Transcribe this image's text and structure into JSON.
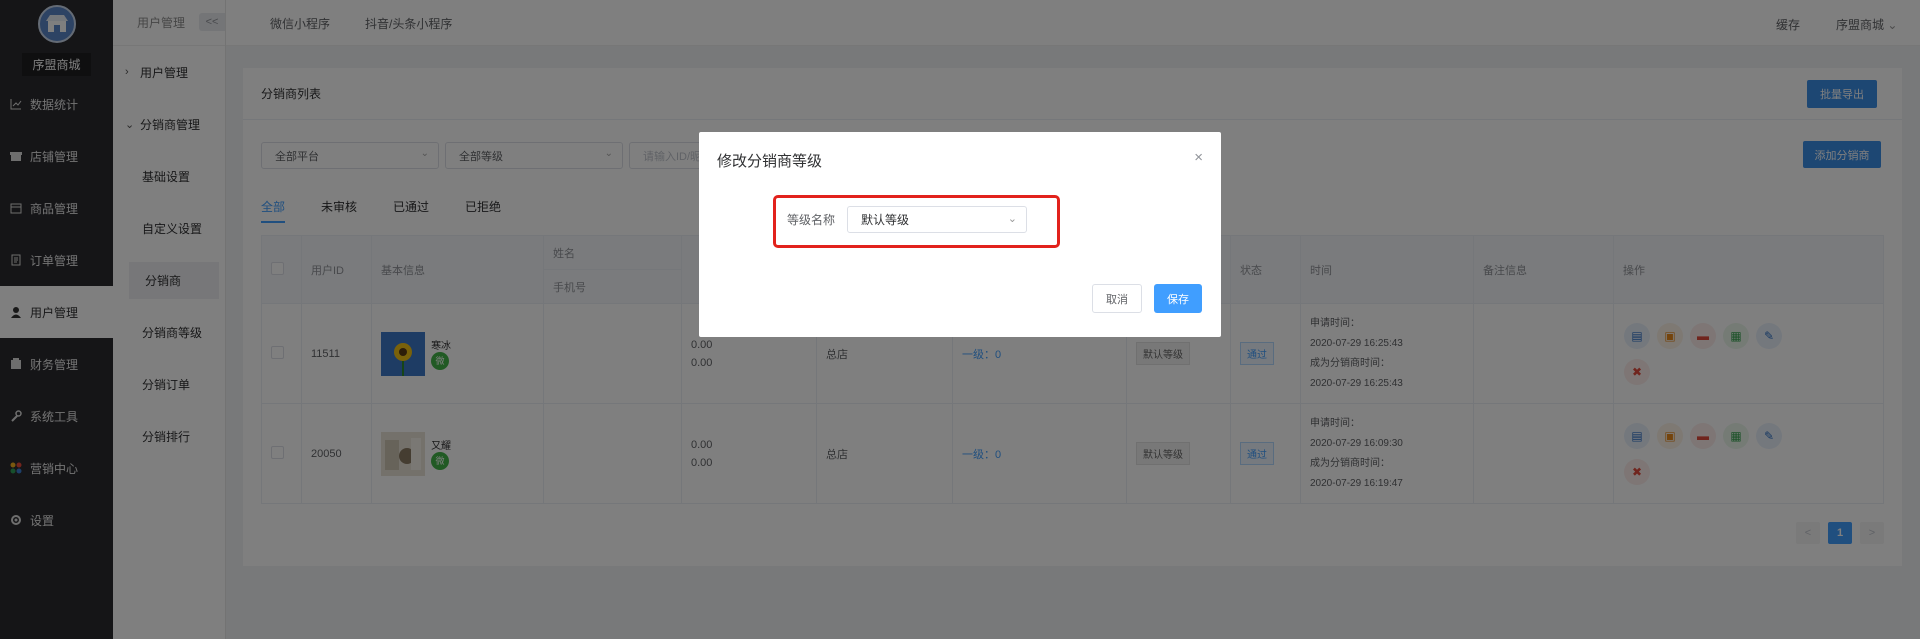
{
  "brand": {
    "name": "序盟商城"
  },
  "nav": [
    {
      "label": "数据统计",
      "icon": "chart-icon"
    },
    {
      "label": "店铺管理",
      "icon": "store-icon"
    },
    {
      "label": "商品管理",
      "icon": "goods-icon"
    },
    {
      "label": "订单管理",
      "icon": "order-icon"
    },
    {
      "label": "用户管理",
      "icon": "user-icon"
    },
    {
      "label": "财务管理",
      "icon": "finance-icon"
    },
    {
      "label": "系统工具",
      "icon": "wrench-icon"
    },
    {
      "label": "营销中心",
      "icon": "marketing-icon"
    },
    {
      "label": "设置",
      "icon": "gear-icon"
    }
  ],
  "sub_nav": {
    "title": "用户管理",
    "collapse": "<<",
    "group1": "用户管理",
    "group2": "分销商管理",
    "items": [
      "基础设置",
      "自定义设置",
      "分销商",
      "分销商等级",
      "分销订单",
      "分销排行"
    ]
  },
  "topbar": {
    "tab1": "微信小程序",
    "tab2": "抖音/头条小程序",
    "cache": "缓存",
    "user": "序盟商城"
  },
  "card": {
    "title": "分销商列表",
    "export_button": "批量导出",
    "add_button": "添加分销商",
    "filter_platform": "全部平台",
    "filter_level": "全部等级",
    "search_placeholder": "请输入ID/昵称"
  },
  "tabs": [
    "全部",
    "未审核",
    "已通过",
    "已拒绝"
  ],
  "table": {
    "headers": {
      "user_id": "用户ID",
      "basic_info": "基本信息",
      "name": "姓名",
      "phone": "手机号",
      "status": "状态",
      "time": "时间",
      "remark": "备注信息",
      "actions": "操作"
    },
    "rows": [
      {
        "id": "11511",
        "nickname": "寒冰",
        "amount1": "0.00",
        "amount2": "0.00",
        "shop": "总店",
        "team": "一级：0",
        "level": "默认等级",
        "status": "通过",
        "apply_label": "申请时间：",
        "apply_time": "2020-07-29 16:25:43",
        "become_label": "成为分销商时间：",
        "become_time": "2020-07-29 16:25:43"
      },
      {
        "id": "20050",
        "nickname": "又耀",
        "amount1": "0.00",
        "amount2": "0.00",
        "shop": "总店",
        "team": "一级：0",
        "level": "默认等级",
        "status": "通过",
        "apply_label": "申请时间：",
        "apply_time": "2020-07-29 16:09:30",
        "become_label": "成为分销商时间：",
        "become_time": "2020-07-29 16:19:47"
      }
    ],
    "wechat_badge": "微"
  },
  "pagination": {
    "prev": "<",
    "current": "1",
    "next": ">"
  },
  "dialog": {
    "title": "修改分销商等级",
    "close": "×",
    "field_label": "等级名称",
    "field_value": "默认等级",
    "cancel": "取消",
    "save": "保存"
  }
}
